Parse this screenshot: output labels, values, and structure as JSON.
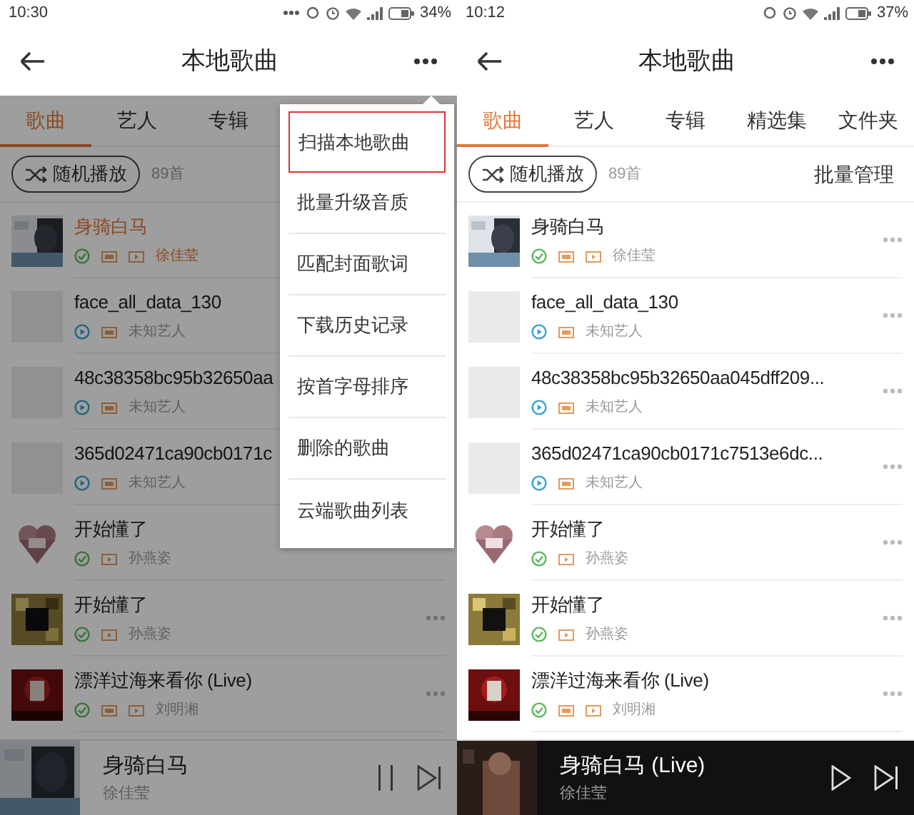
{
  "panels": [
    {
      "status_bar": {
        "time": "10:30",
        "battery": "34%",
        "notification_dots": true
      },
      "header": {
        "title": "本地歌曲"
      },
      "tabs": [
        {
          "label": "歌曲",
          "selected": true
        },
        {
          "label": "艺人",
          "selected": false
        },
        {
          "label": "专辑",
          "selected": false
        }
      ],
      "shuffle": {
        "label": "随机播放",
        "count": "89首"
      },
      "songs": [
        {
          "title": "身骑白马",
          "artist": "徐佳莹",
          "playing": true,
          "downloaded": true,
          "hq": true,
          "mv": true,
          "has_cover": true
        },
        {
          "title": "face_all_data_130",
          "artist": "未知艺人",
          "playing": false,
          "downloaded": false,
          "hq": true,
          "mv": false,
          "has_cover": false
        },
        {
          "title": "48c38358bc95b32650aa",
          "artist": "未知艺人",
          "playing": false,
          "downloaded": false,
          "hq": true,
          "mv": false,
          "has_cover": false
        },
        {
          "title": "365d02471ca90cb0171c",
          "artist": "未知艺人",
          "playing": false,
          "downloaded": false,
          "hq": true,
          "mv": false,
          "has_cover": false
        },
        {
          "title": "开始懂了",
          "artist": "孙燕姿",
          "playing": false,
          "downloaded": true,
          "hq": false,
          "mv": true,
          "has_cover": true
        },
        {
          "title": "开始懂了",
          "artist": "孙燕姿",
          "playing": false,
          "downloaded": true,
          "hq": false,
          "mv": true,
          "has_cover": true
        },
        {
          "title": "漂洋过海来看你 (Live)",
          "artist": "刘明湘",
          "playing": false,
          "downloaded": true,
          "hq": true,
          "mv": true,
          "has_cover": true
        }
      ],
      "player": {
        "title": "身骑白马",
        "artist": "徐佳莹",
        "playing": true
      },
      "menu": {
        "items": [
          {
            "label": "扫描本地歌曲",
            "selected": true
          },
          {
            "label": "批量升级音质",
            "selected": false
          },
          {
            "label": "匹配封面歌词",
            "selected": false
          },
          {
            "label": "下载历史记录",
            "selected": false
          },
          {
            "label": "按首字母排序",
            "selected": false
          },
          {
            "label": "删除的歌曲",
            "selected": false
          },
          {
            "label": "云端歌曲列表",
            "selected": false
          }
        ]
      },
      "dimmed": true
    },
    {
      "status_bar": {
        "time": "10:12",
        "battery": "37%",
        "notification_dots": false
      },
      "header": {
        "title": "本地歌曲"
      },
      "tabs": [
        {
          "label": "歌曲",
          "selected": true
        },
        {
          "label": "艺人",
          "selected": false
        },
        {
          "label": "专辑",
          "selected": false
        },
        {
          "label": "精选集",
          "selected": false
        },
        {
          "label": "文件夹",
          "selected": false
        }
      ],
      "shuffle": {
        "label": "随机播放",
        "count": "89首",
        "action": "批量管理"
      },
      "songs": [
        {
          "title": "身骑白马",
          "artist": "徐佳莹",
          "playing": false,
          "downloaded": true,
          "hq": true,
          "mv": true,
          "has_cover": true
        },
        {
          "title": "face_all_data_130",
          "artist": "未知艺人",
          "playing": false,
          "downloaded": false,
          "hq": true,
          "mv": false,
          "has_cover": false
        },
        {
          "title": "48c38358bc95b32650aa045dff209...",
          "artist": "未知艺人",
          "playing": false,
          "downloaded": false,
          "hq": true,
          "mv": false,
          "has_cover": false
        },
        {
          "title": "365d02471ca90cb0171c7513e6dc...",
          "artist": "未知艺人",
          "playing": false,
          "downloaded": false,
          "hq": true,
          "mv": false,
          "has_cover": false
        },
        {
          "title": "开始懂了",
          "artist": "孙燕姿",
          "playing": false,
          "downloaded": true,
          "hq": false,
          "mv": true,
          "has_cover": true
        },
        {
          "title": "开始懂了",
          "artist": "孙燕姿",
          "playing": false,
          "downloaded": true,
          "hq": false,
          "mv": true,
          "has_cover": true
        },
        {
          "title": "漂洋过海来看你 (Live)",
          "artist": "刘明湘",
          "playing": false,
          "downloaded": true,
          "hq": true,
          "mv": true,
          "has_cover": true
        }
      ],
      "player": {
        "title": "身骑白马 (Live)",
        "artist": "徐佳莹",
        "playing": false
      },
      "dimmed": false
    }
  ]
}
